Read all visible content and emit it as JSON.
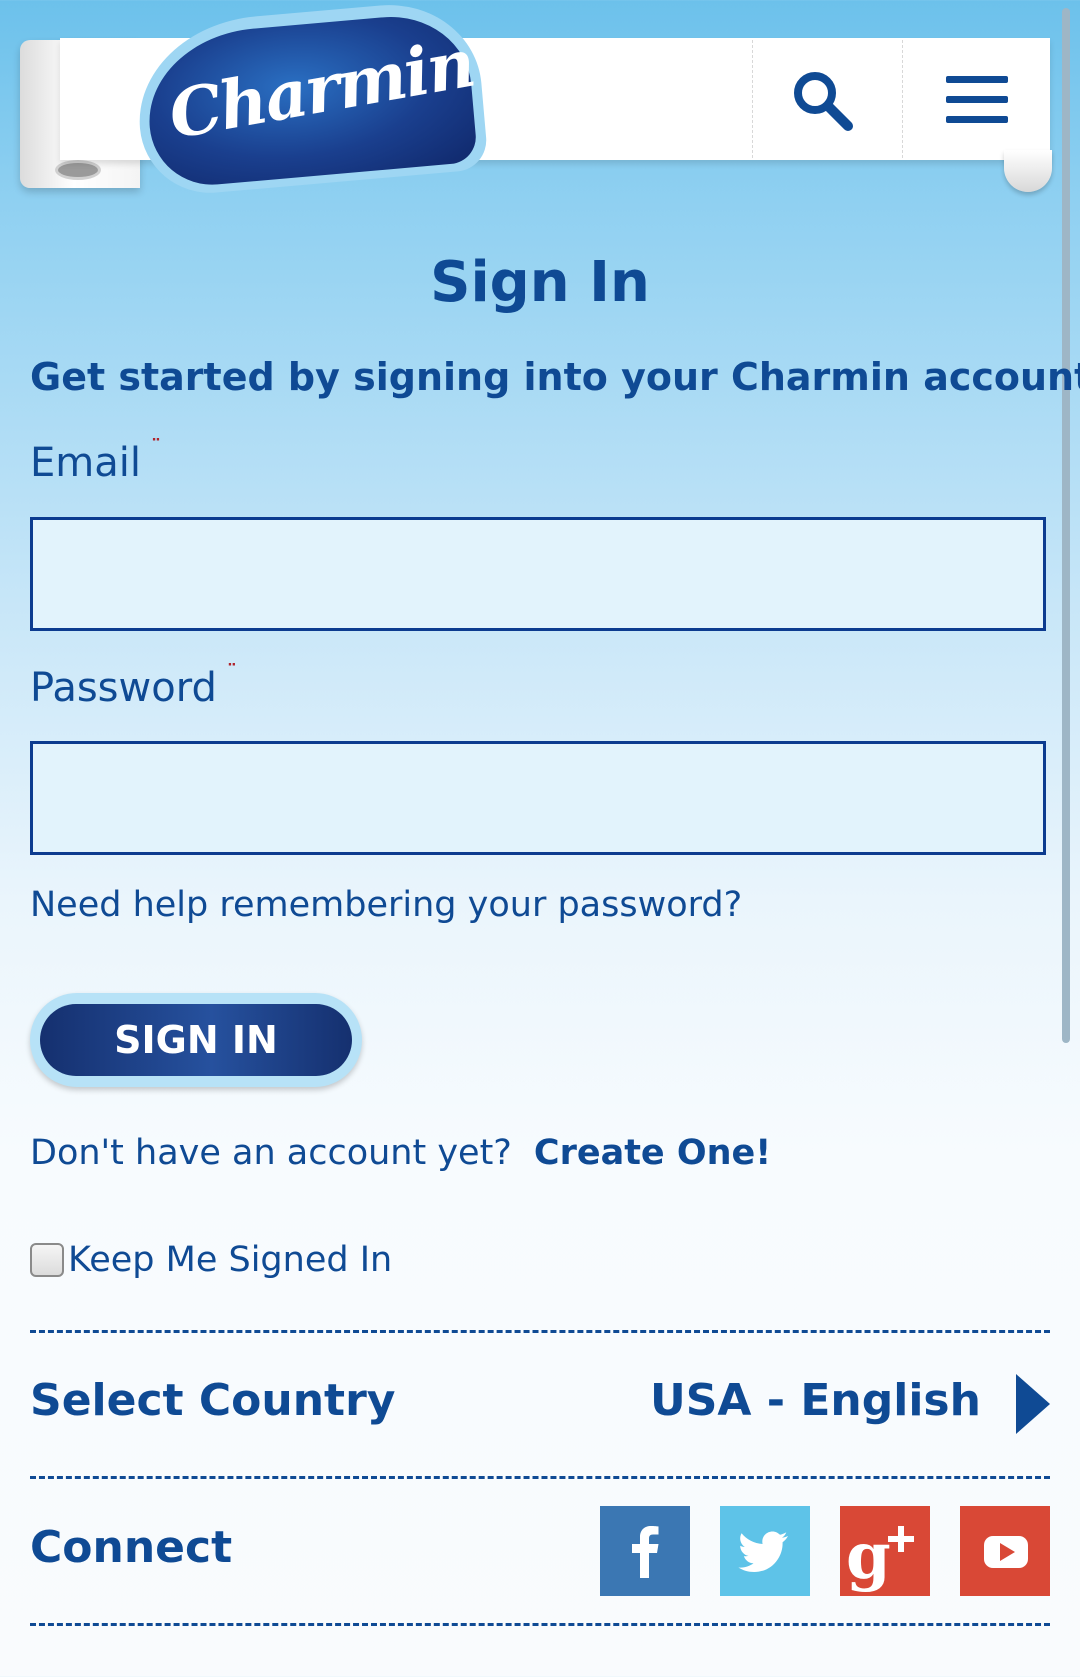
{
  "header": {
    "logo_text": "Charmin",
    "search_icon": "search-icon",
    "menu_icon": "hamburger-menu-icon"
  },
  "main": {
    "title": "Sign In",
    "subtitle": "Get started by signing into your Charmin account.",
    "email_label": "Email",
    "password_label": "Password",
    "required_marker": "¨",
    "email_value": "",
    "password_value": "",
    "help_link": "Need help remembering your  password?",
    "signin_button": "SIGN IN",
    "no_account_text": "Don't have an account yet?",
    "create_link": "Create One!",
    "keep_signed_in": "Keep Me Signed In",
    "keep_signed_in_checked": false
  },
  "footer": {
    "select_country_label": "Select Country",
    "country_value": "USA - English",
    "connect_label": "Connect",
    "social": [
      {
        "name": "facebook-icon",
        "color": "#3b77b3"
      },
      {
        "name": "twitter-icon",
        "color": "#5ec3e8"
      },
      {
        "name": "google-plus-icon",
        "color": "#d94836"
      },
      {
        "name": "youtube-icon",
        "color": "#d94836"
      }
    ]
  },
  "colors": {
    "brand_blue": "#0f4a94",
    "input_border": "#0c3b8f",
    "input_bg": "#e2f3fc",
    "required": "#b0242c"
  }
}
